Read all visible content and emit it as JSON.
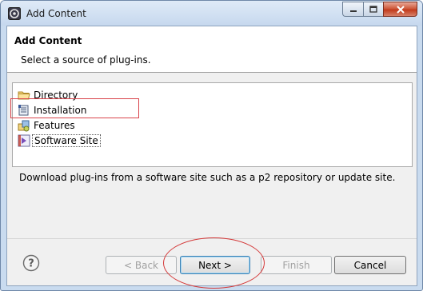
{
  "window": {
    "title": "Add Content"
  },
  "header": {
    "title": "Add Content",
    "description": "Select a source of plug-ins."
  },
  "tree": {
    "items": [
      {
        "label": "Directory",
        "icon": "folder-icon"
      },
      {
        "label": "Installation",
        "icon": "installation-icon"
      },
      {
        "label": "Features",
        "icon": "features-icon"
      },
      {
        "label": "Software Site",
        "icon": "software-site-icon"
      }
    ],
    "selected": "Software Site"
  },
  "description": "Download plug-ins from a software site such as a p2 repository or update site.",
  "buttons": {
    "back": "< Back",
    "next": "Next >",
    "finish": "Finish",
    "cancel": "Cancel"
  },
  "colors": {
    "annotation": "#d43a3a",
    "titlebar": "#c6d8ee"
  }
}
